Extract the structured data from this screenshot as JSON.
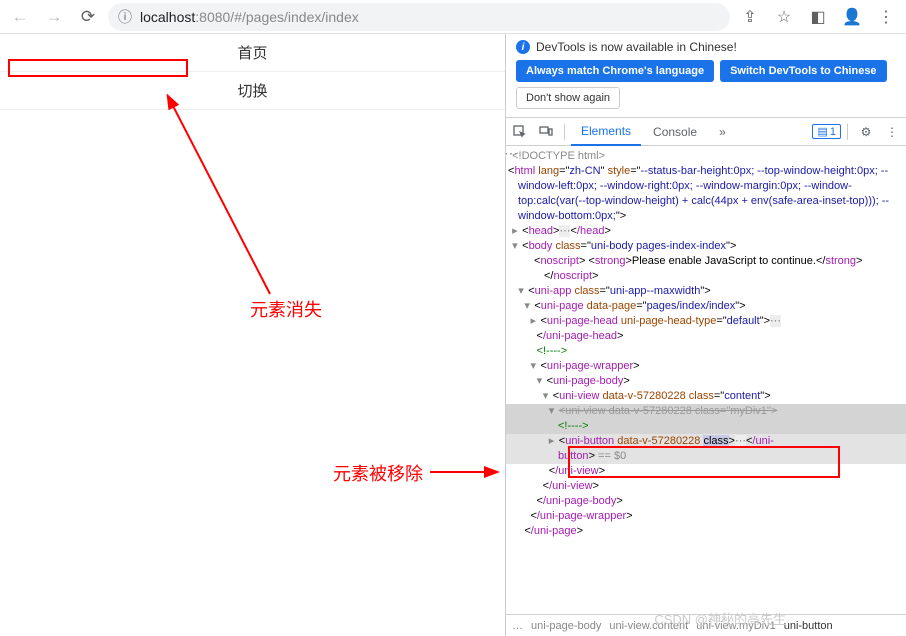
{
  "toolbar": {
    "url_scheme": "localhost",
    "url_rest": ":8080/#/pages/index/index"
  },
  "page": {
    "title": "首页",
    "switch": "切换"
  },
  "annotations": {
    "disappear": "元素消失",
    "removed": "元素被移除"
  },
  "devtools": {
    "banner_text": "DevTools is now available in Chinese!",
    "btn_match": "Always match Chrome's language",
    "btn_switch": "Switch DevTools to Chinese",
    "btn_dont": "Don't show again",
    "tabs": {
      "elements": "Elements",
      "console": "Console",
      "more": "»"
    },
    "msg_count": "1"
  },
  "dom": {
    "l0": "<!DOCTYPE html>",
    "l1a": "html",
    "l1b": "lang",
    "l1c": "zh-CN",
    "l1d": "style",
    "l1e": "--status-bar-height:0px; --top-window-height:0px; --window-left:0px; --window-right:0px; --window-margin:0px; --window-top:calc(var(--top-window-height) + calc(44px + env(safe-area-inset-top))); --window-bottom:0px;",
    "l2": "head",
    "l2c": "/head",
    "l3": "body",
    "l3c": "class",
    "l3v": "uni-body pages-index-index",
    "l4a": "noscript",
    "l4b": "strong",
    "l4t": "Please enable JavaScript to continue.",
    "l5": "uni-app",
    "l5c": "class",
    "l5v": "uni-app--maxwidth",
    "l6": "uni-page",
    "l6a": "data-page",
    "l6v": "pages/index/index",
    "l7": "uni-page-head",
    "l7a": "uni-page-head-type",
    "l7v": "default",
    "l7c": "/uni-page-head",
    "l8": "<!---->",
    "l9": "uni-page-wrapper",
    "l10": "uni-page-body",
    "l11": "uni-view",
    "l11a": "data-v-57280228",
    "l11c": "class",
    "l11v": "content",
    "l12": "uni-view data-v-57280228 class=\"myDiv1\"",
    "l13": "<!---->",
    "l14": "uni-button",
    "l14a": "data-v-57280228",
    "l14c": "class",
    "l14end": "/uni-button",
    "l14eq": " == $0",
    "l15": "/uni-view",
    "l16": "/uni-view",
    "l17": "/uni-page-body",
    "l18": "/uni-page-wrapper",
    "l19": "/uni-page"
  },
  "crumb": {
    "c1": "uni-page-body",
    "c2": "uni-view.content",
    "c3": "uni-view.myDiv1",
    "c4": "uni-button"
  },
  "watermark": "CSDN @神秘的高先生"
}
